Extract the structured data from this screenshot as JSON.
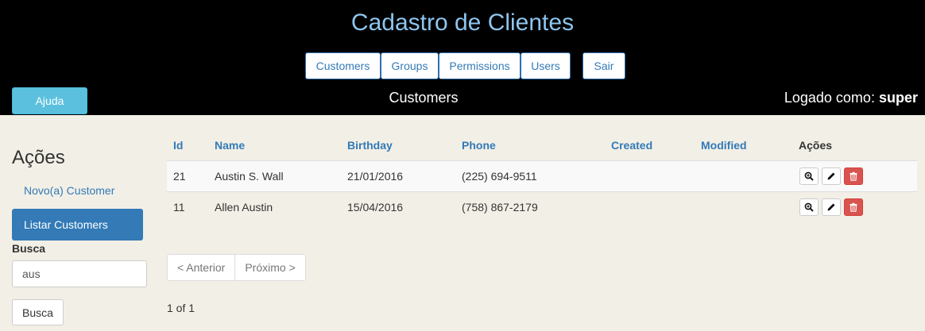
{
  "header": {
    "title": "Cadastro de Clientes",
    "nav": [
      "Customers",
      "Groups",
      "Permissions",
      "Users"
    ],
    "logout_label": "Sair",
    "help_label": "Ajuda",
    "section_title": "Customers",
    "logged_prefix": "Logado como:",
    "logged_user": "super"
  },
  "sidebar": {
    "title": "Ações",
    "new_link": "Novo(a) Customer",
    "list_link": "Listar Customers",
    "search_label": "Busca",
    "search_value": "aus",
    "search_button": "Busca"
  },
  "table": {
    "headers": {
      "id": "Id",
      "name": "Name",
      "birthday": "Birthday",
      "phone": "Phone",
      "created": "Created",
      "modified": "Modified",
      "actions": "Ações"
    },
    "rows": [
      {
        "id": "21",
        "name": "Austin S. Wall",
        "birthday": "21/01/2016",
        "phone": "(225) 694-9511",
        "created": "",
        "modified": ""
      },
      {
        "id": "11",
        "name": "Allen Austin",
        "birthday": "15/04/2016",
        "phone": "(758) 867-2179",
        "created": "",
        "modified": ""
      }
    ]
  },
  "pagination": {
    "prev": "< Anterior",
    "next": "Próximo >",
    "count": "1 of 1"
  },
  "colors": {
    "header_bg": "#000000",
    "title": "#8ec5ee",
    "link": "#337ab7",
    "help": "#5bc0de",
    "danger": "#d9534f"
  },
  "icons": [
    "zoom-in-icon",
    "pencil-icon",
    "trash-icon"
  ]
}
